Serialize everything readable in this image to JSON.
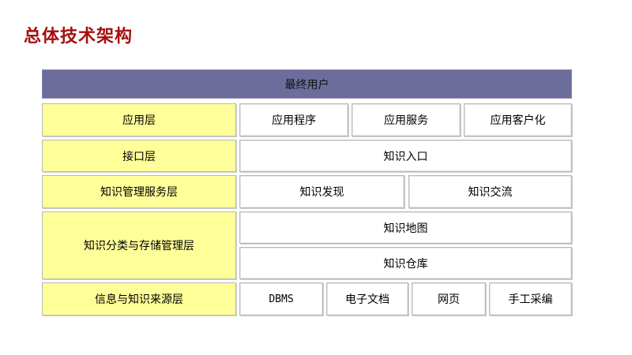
{
  "title": "总体技术架构",
  "end_user": "最终用户",
  "layers": {
    "application": {
      "label": "应用层",
      "items": [
        "应用程序",
        "应用服务",
        "应用客户化"
      ]
    },
    "interface": {
      "label": "接口层",
      "items": [
        "知识入口"
      ]
    },
    "knowledge_service": {
      "label": "知识管理服务层",
      "items": [
        "知识发现",
        "知识交流"
      ]
    },
    "classification_storage": {
      "label": "知识分类与存储管理层",
      "items": [
        "知识地图",
        "知识仓库"
      ]
    },
    "sources": {
      "label": "信息与知识来源层",
      "items": [
        "DBMS",
        "电子文档",
        "网页",
        "手工采编"
      ]
    }
  },
  "colors": {
    "title": "#a50f0f",
    "end_user_bg": "#6d6d9c",
    "layer_bg": "#ffff99",
    "cell_bg": "#ffffff",
    "border": "#b9b9b9"
  }
}
